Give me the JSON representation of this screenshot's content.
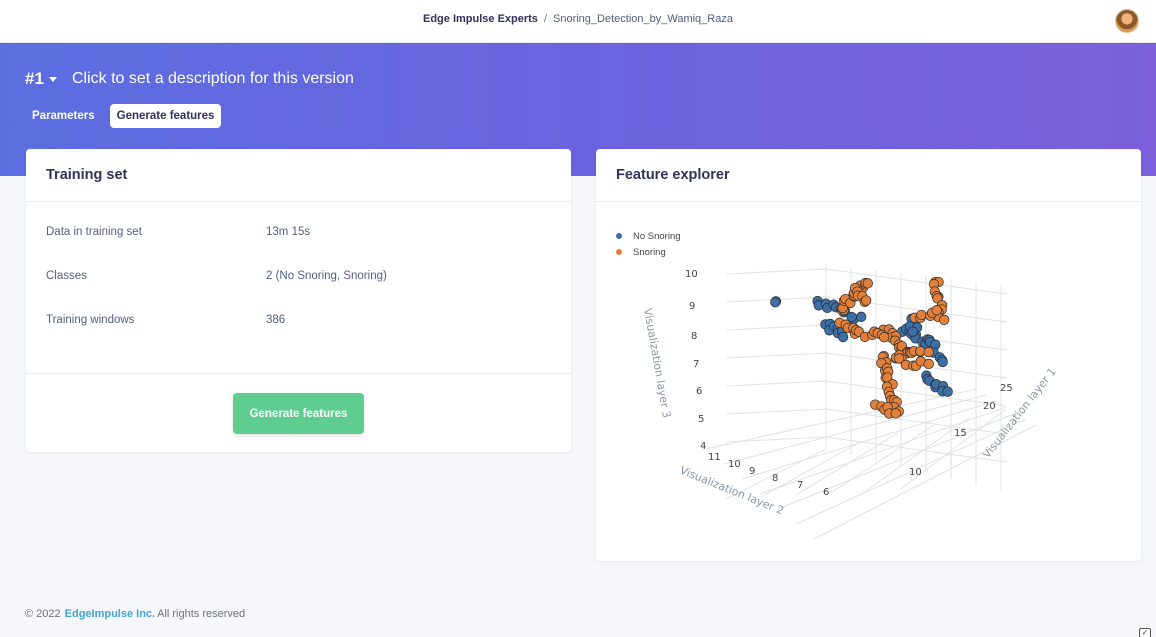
{
  "breadcrumb": {
    "org": "Edge Impulse Experts",
    "separator": "/",
    "project": "Snoring_Detection_by_Wamiq_Raza"
  },
  "header": {
    "version": "#1",
    "description": "Click to set a description for this version"
  },
  "tabs": [
    {
      "label": "Parameters"
    },
    {
      "label": "Generate features"
    }
  ],
  "training": {
    "title": "Training set",
    "rows": [
      {
        "key": "Data in training set",
        "value": "13m 15s"
      },
      {
        "key": "Classes",
        "value": "2 (No Snoring, Snoring)"
      },
      {
        "key": "Training windows",
        "value": "386"
      }
    ],
    "button": "Generate features"
  },
  "explorer": {
    "title": "Feature explorer"
  },
  "chart_data": {
    "type": "scatter",
    "dimensions": 3,
    "legend_position": "top-left",
    "series": [
      {
        "name": "No Snoring",
        "color": "#3b6fa8"
      },
      {
        "name": "Snoring",
        "color": "#e2803a"
      }
    ],
    "axes": {
      "x": {
        "label": "Visualization layer 1",
        "ticks": [
          "10",
          "15",
          "20",
          "25"
        ]
      },
      "y": {
        "label": "Visualization layer 2",
        "ticks": [
          "11",
          "10",
          "9",
          "8",
          "7",
          "6"
        ]
      },
      "z": {
        "label": "Visualization layer 3",
        "ticks": [
          "4",
          "5",
          "6",
          "7",
          "8",
          "9",
          "10"
        ]
      }
    }
  },
  "footer": {
    "copyright": "© 2022",
    "brand": "EdgeImpulse Inc.",
    "rights": "All rights reserved"
  },
  "colors": {
    "accent": "#5b6ee0",
    "button": "#5fcd8f",
    "brand_link": "#3fa7c9"
  }
}
